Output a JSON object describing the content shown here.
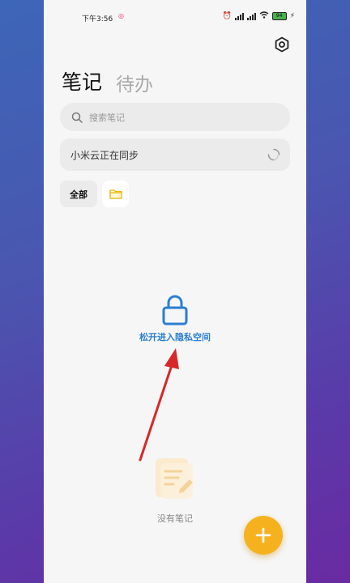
{
  "status_bar": {
    "time": "下午3:56",
    "battery": "94"
  },
  "tabs": {
    "notes": "笔记",
    "todo": "待办"
  },
  "search": {
    "placeholder": "搜索笔记"
  },
  "sync": {
    "text": "小米云正在同步"
  },
  "filters": {
    "all": "全部"
  },
  "private_space": {
    "hint": "松开进入隐私空间"
  },
  "empty": {
    "text": "没有笔记"
  },
  "colors": {
    "accent": "#f6b21e",
    "lock_blue": "#2a7fd0",
    "arrow_red": "#d62828"
  }
}
